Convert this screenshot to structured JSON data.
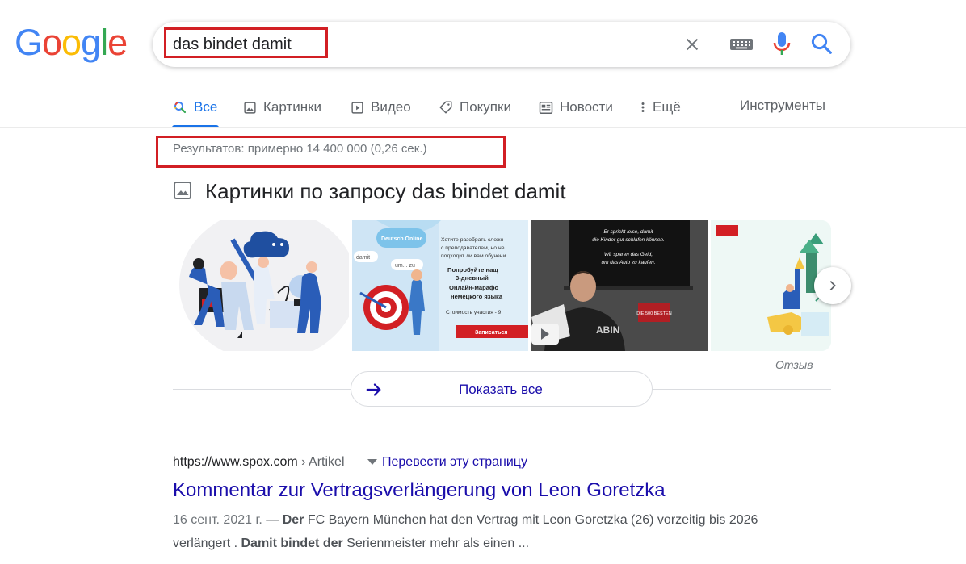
{
  "logo": {
    "text": "Google",
    "letters": [
      {
        "ch": "G",
        "color": "#4285F4"
      },
      {
        "ch": "o",
        "color": "#EA4335"
      },
      {
        "ch": "o",
        "color": "#FBBC05"
      },
      {
        "ch": "g",
        "color": "#4285F4"
      },
      {
        "ch": "l",
        "color": "#34A853"
      },
      {
        "ch": "e",
        "color": "#EA4335"
      }
    ]
  },
  "search": {
    "query": "das bindet damit"
  },
  "tabs": [
    {
      "label": "Все",
      "icon": "search-icon"
    },
    {
      "label": "Картинки",
      "icon": "image-icon"
    },
    {
      "label": "Видео",
      "icon": "video-icon"
    },
    {
      "label": "Покупки",
      "icon": "tag-icon"
    },
    {
      "label": "Новости",
      "icon": "news-icon"
    },
    {
      "label": "Ещё",
      "icon": "more-vert-icon"
    }
  ],
  "tools_label": "Инструменты",
  "stats": "Результатов: примерно 14 400 000 (0,26 сек.)",
  "images": {
    "heading": "Картинки по запросу das bindet damit",
    "thumb2": {
      "brand": "Deutsch Online",
      "word1": "damit",
      "word2": "um... zu",
      "line1": "Хотите разобрать сложн",
      "line2": "с преподавателем, но не",
      "line3": "подходит ли вам обучени",
      "cta_l1": "Попробуйте нащ",
      "cta_l2": "3-дневный",
      "cta_l3": "Онлайн-марафо",
      "cta_l4": "немецкого языка",
      "price": "Стоимость участия - 9",
      "button": "Записаться"
    },
    "thumb3": {
      "line1": "Er spricht leise, damit",
      "line2": "die Kinder gut schlafen können.",
      "line3": "Wir sparen das Geld,",
      "line4": "um das Auto zu kaufen.",
      "badge": "DIE 500 BESTEN",
      "shirt": "ABIN"
    },
    "feedback": "Отзыв",
    "show_all": "Показать все"
  },
  "result": {
    "url": "https://www.spox.com",
    "crumb": " › Artikel",
    "translate": "Перевести эту страницу",
    "title": "Kommentar zur Vertragsverlängerung von Leon Goretzka",
    "date": "16 сент. 2021 г. — ",
    "s1": "Der",
    "s2": " FC Bayern München hat den Vertrag mit Leon Goretzka (26) vorzeitig bis 2026 verlängert . ",
    "s3": "Damit bindet der",
    "s4": " Serienmeister mehr als einen ..."
  },
  "colors": {
    "accent": "#1a73e8",
    "link": "#1a0dab",
    "highlight_box": "#d21f24"
  }
}
